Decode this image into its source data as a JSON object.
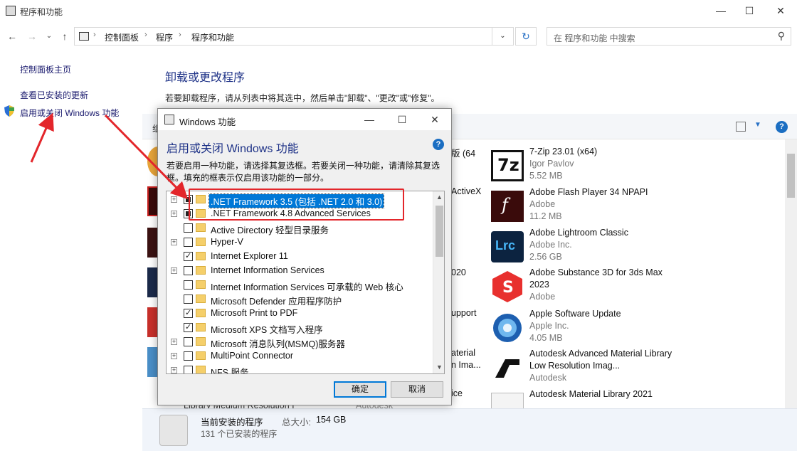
{
  "window": {
    "title": "程序和功能",
    "minimize": "—",
    "maximize": "☐",
    "close": "✕"
  },
  "nav": {
    "back": "←",
    "forward": "→",
    "recent": "⌄",
    "up": "↑"
  },
  "breadcrumb": [
    "控制面板",
    "程序",
    "程序和功能"
  ],
  "breadcrumb_sep": "›",
  "address_dropdown": "⌄",
  "refresh": "↻",
  "search": {
    "placeholder": "在 程序和功能 中搜索",
    "icon": "⚲"
  },
  "sidebar": {
    "items": [
      {
        "label": "控制面板主页"
      },
      {
        "label": "查看已安装的更新"
      },
      {
        "label": "启用或关闭 Windows 功能"
      }
    ]
  },
  "main": {
    "title": "卸载或更改程序",
    "description": "若要卸载程序，请从列表中将其选中，然后单击\"卸载\"、\"更改\"或\"修复\"。",
    "toolbar_label": "组",
    "view_dropdown": "▼",
    "help": "?"
  },
  "programs_partial": [
    {
      "text": "版 (64"
    },
    {
      "text": "ActiveX"
    },
    {
      "text": "020"
    },
    {
      "text": "upport"
    },
    {
      "text": "aterial"
    },
    {
      "text": "n Ima..."
    },
    {
      "text": "ice"
    }
  ],
  "programs": [
    {
      "name": "7-Zip 23.01 (x64)",
      "publisher": "Igor Pavlov",
      "size": "5.52 MB",
      "icon": "7z-icon"
    },
    {
      "name": "Adobe Flash Player 34 NPAPI",
      "publisher": "Adobe",
      "size": "11.2 MB",
      "icon": "flash-icon"
    },
    {
      "name": "Adobe Lightroom Classic",
      "publisher": "Adobe Inc.",
      "size": "2.56 GB",
      "icon": "lightroom-icon"
    },
    {
      "name": "Adobe Substance 3D for 3ds Max 2023",
      "publisher": "Adobe",
      "size": "",
      "icon": "substance-icon"
    },
    {
      "name": "Apple Software Update",
      "publisher": "Apple Inc.",
      "size": "4.05 MB",
      "icon": "apple-update-icon"
    },
    {
      "name": "Autodesk Advanced Material Library Low Resolution Imag...",
      "publisher": "Autodesk",
      "size": "",
      "icon": "autodesk-icon"
    },
    {
      "name": "Autodesk Material Library 2021",
      "publisher": "",
      "size": "",
      "icon": "autodesk-doc-icon"
    }
  ],
  "bottom_peek": {
    "left": "Library Medium Resolution I",
    "mid": "Autodesk"
  },
  "status": {
    "line1": "当前安装的程序",
    "size_label": "总大小:",
    "size_value": "154 GB",
    "line2": "131 个已安装的程序"
  },
  "dialog": {
    "title": "Windows 功能",
    "heading": "启用或关闭 Windows 功能",
    "help": "?",
    "description": "若要启用一种功能，请选择其复选框。若要关闭一种功能，请清除其复选框。填充的框表示仅启用该功能的一部分。",
    "features": [
      {
        "label": ".NET Framework 3.5 (包括 .NET 2.0 和 3.0)",
        "expandable": true,
        "state": "partial",
        "selected": true
      },
      {
        "label": ".NET Framework 4.8 Advanced Services",
        "expandable": true,
        "state": "partial",
        "selected": false
      },
      {
        "label": "Active Directory 轻型目录服务",
        "expandable": false,
        "state": "unchecked",
        "selected": false
      },
      {
        "label": "Hyper-V",
        "expandable": true,
        "state": "unchecked",
        "selected": false
      },
      {
        "label": "Internet Explorer 11",
        "expandable": false,
        "state": "checked",
        "selected": false
      },
      {
        "label": "Internet Information Services",
        "expandable": true,
        "state": "unchecked",
        "selected": false
      },
      {
        "label": "Internet Information Services 可承载的 Web 核心",
        "expandable": false,
        "state": "unchecked",
        "selected": false
      },
      {
        "label": "Microsoft Defender 应用程序防护",
        "expandable": false,
        "state": "unchecked",
        "selected": false
      },
      {
        "label": "Microsoft Print to PDF",
        "expandable": false,
        "state": "checked",
        "selected": false
      },
      {
        "label": "Microsoft XPS 文档写入程序",
        "expandable": false,
        "state": "checked",
        "selected": false
      },
      {
        "label": "Microsoft 消息队列(MSMQ)服务器",
        "expandable": true,
        "state": "unchecked",
        "selected": false
      },
      {
        "label": "MultiPoint Connector",
        "expandable": true,
        "state": "unchecked",
        "selected": false
      },
      {
        "label": "NFS 服务",
        "expandable": true,
        "state": "unchecked",
        "selected": false
      }
    ],
    "ok": "确定",
    "cancel": "取消"
  }
}
